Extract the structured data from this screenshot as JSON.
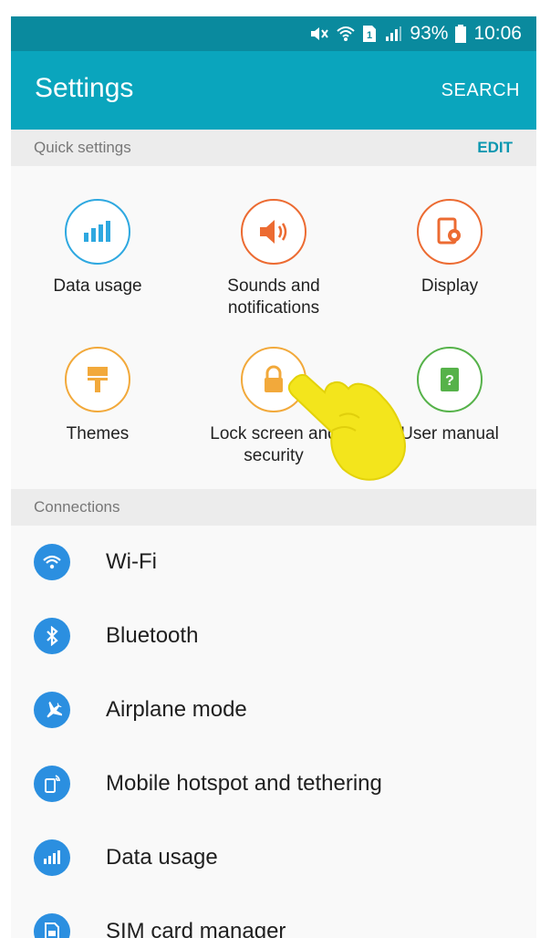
{
  "status_bar": {
    "battery": "93%",
    "time": "10:06",
    "icons": [
      "mute-icon",
      "wifi-icon",
      "sim-icon",
      "signal-icon",
      "battery-icon"
    ]
  },
  "app_bar": {
    "title": "Settings",
    "search_label": "SEARCH"
  },
  "quick_settings": {
    "header": "Quick settings",
    "edit_label": "EDIT",
    "items": [
      {
        "label": "Data usage",
        "icon": "data-usage-icon",
        "color": "#2ea8e0"
      },
      {
        "label": "Sounds and notifications",
        "icon": "speaker-icon",
        "color": "#ec6b32"
      },
      {
        "label": "Display",
        "icon": "display-icon",
        "color": "#ec6b32"
      },
      {
        "label": "Themes",
        "icon": "paint-roller-icon",
        "color": "#f2a93b"
      },
      {
        "label": "Lock screen and security",
        "icon": "lock-icon",
        "color": "#f2a93b"
      },
      {
        "label": "User manual",
        "icon": "user-manual-icon",
        "color": "#56b24a"
      }
    ]
  },
  "connections": {
    "header": "Connections",
    "items": [
      {
        "label": "Wi-Fi",
        "icon": "wifi-icon"
      },
      {
        "label": "Bluetooth",
        "icon": "bluetooth-icon"
      },
      {
        "label": "Airplane mode",
        "icon": "airplane-icon"
      },
      {
        "label": "Mobile hotspot and tethering",
        "icon": "hotspot-icon"
      },
      {
        "label": "Data usage",
        "icon": "data-usage-icon"
      },
      {
        "label": "SIM card manager",
        "icon": "sim-card-icon"
      }
    ]
  },
  "colors": {
    "status_bar": "#0a8a9e",
    "app_bar": "#0aa5bd",
    "accent": "#0b97b0",
    "list_icon": "#2b8fe0"
  }
}
